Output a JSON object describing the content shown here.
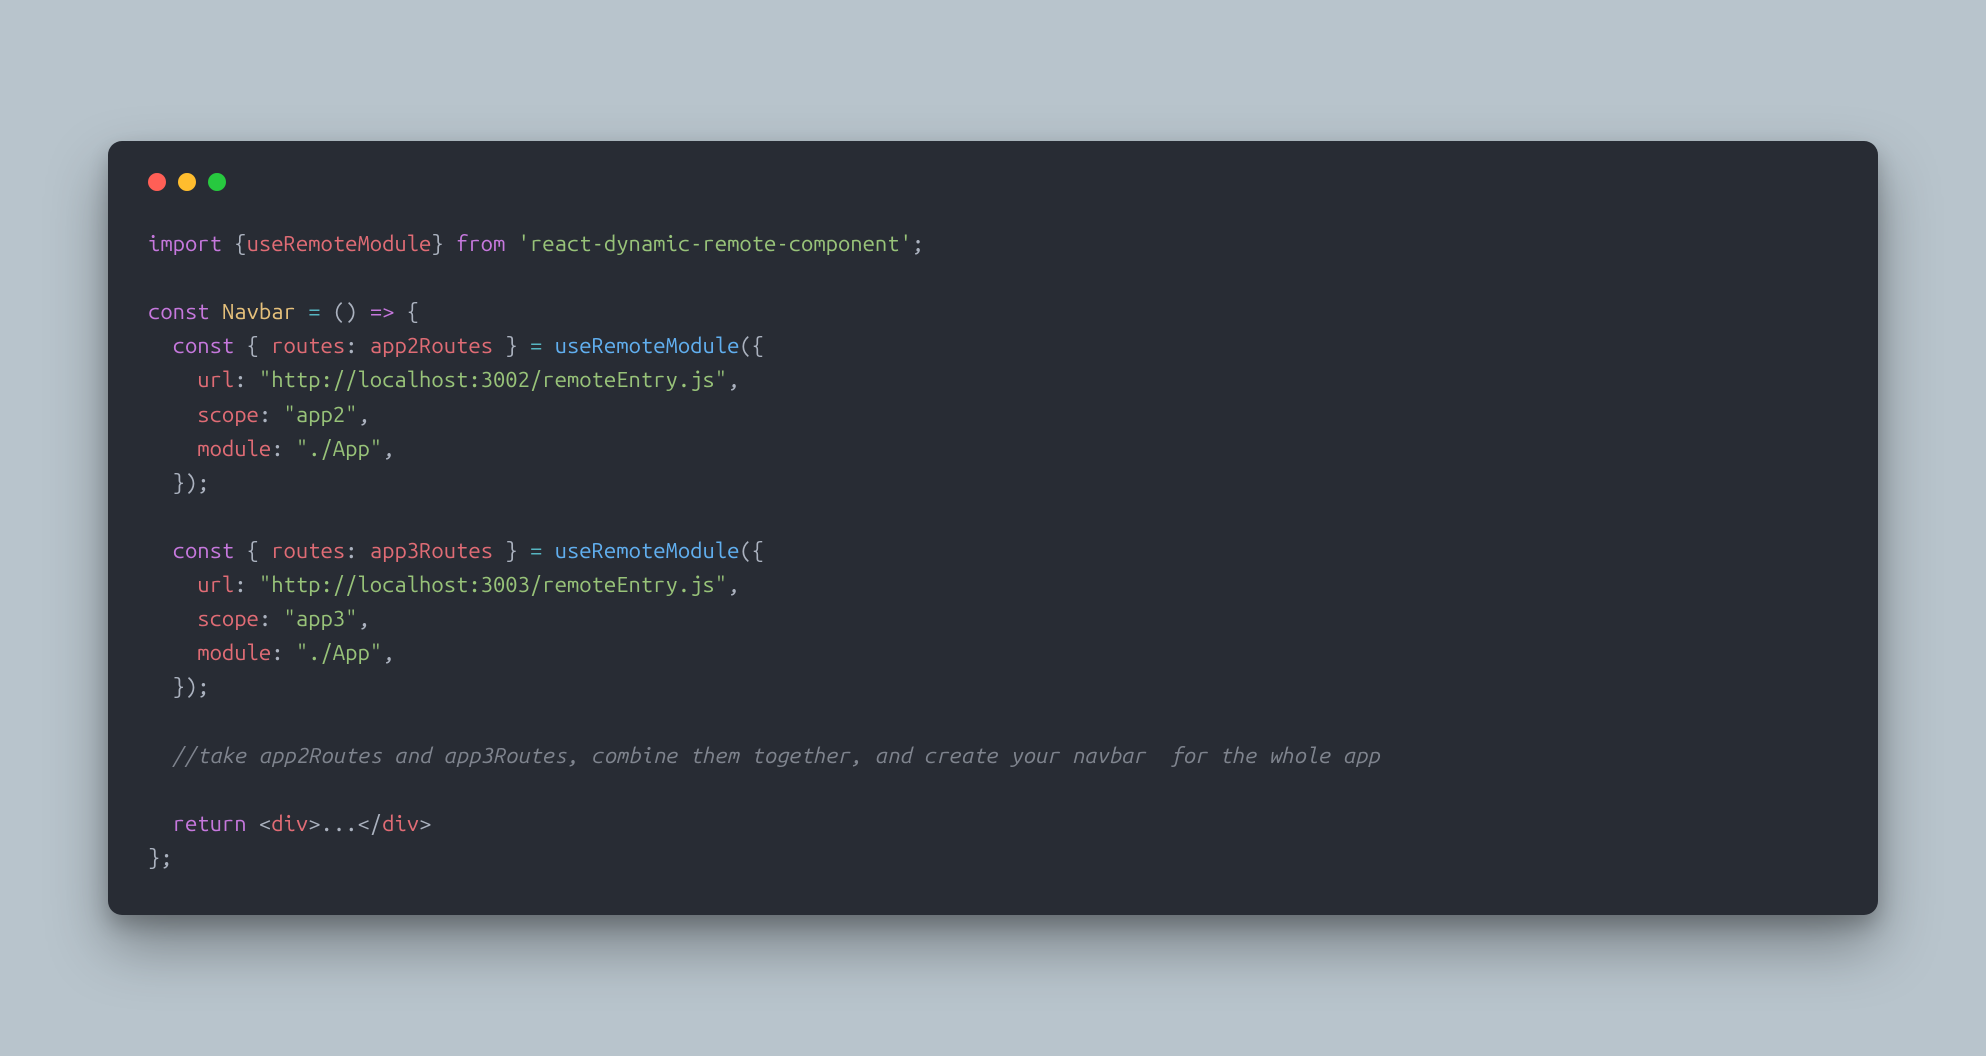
{
  "window": {
    "controls": [
      "close",
      "minimize",
      "zoom"
    ]
  },
  "code": {
    "line1": {
      "import": "import",
      "lbrace": "{",
      "useRemoteModule": "useRemoteModule",
      "rbrace": "}",
      "from": "from",
      "pkg": "'react-dynamic-remote-component'",
      "semi": ";"
    },
    "line3": {
      "const": "const",
      "Navbar": "Navbar",
      "eq": "=",
      "lparen": "(",
      "rparen": ")",
      "arrow": "=>",
      "lbrace": "{"
    },
    "block1": {
      "const": "const",
      "lbrace": "{",
      "routes": "routes",
      "colon": ":",
      "alias": "app2Routes",
      "rbrace": "}",
      "eq": "=",
      "fn": "useRemoteModule",
      "lparen": "(",
      "objl": "{",
      "url_key": "url",
      "url_val": "\"http://localhost:3002/remoteEntry.js\"",
      "scope_key": "scope",
      "scope_val": "\"app2\"",
      "module_key": "module",
      "module_val": "\"./App\"",
      "objr": "}",
      "rparen": ")",
      "semi": ";"
    },
    "block2": {
      "const": "const",
      "lbrace": "{",
      "routes": "routes",
      "colon": ":",
      "alias": "app3Routes",
      "rbrace": "}",
      "eq": "=",
      "fn": "useRemoteModule",
      "lparen": "(",
      "objl": "{",
      "url_key": "url",
      "url_val": "\"http://localhost:3003/remoteEntry.js\"",
      "scope_key": "scope",
      "scope_val": "\"app3\"",
      "module_key": "module",
      "module_val": "\"./App\"",
      "objr": "}",
      "rparen": ")",
      "semi": ";"
    },
    "comment": "//take app2Routes and app3Routes, combine them together, and create your navbar  for the whole app",
    "ret": {
      "return": "return",
      "lt1": "<",
      "div": "div",
      "gt1": ">",
      "dots": "...",
      "lt2": "</",
      "gt2": ">"
    },
    "close": "};"
  }
}
